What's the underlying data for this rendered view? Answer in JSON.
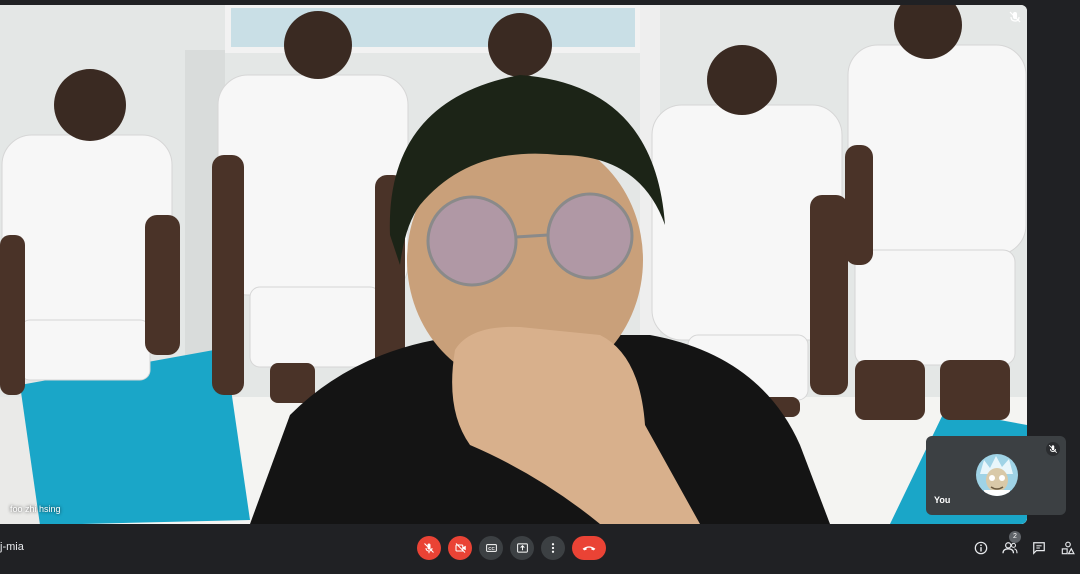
{
  "meeting": {
    "code_partial": "j-mia"
  },
  "main_tile": {
    "participant_name": "foo zhi hsing",
    "muted_icon": "mic-off-icon"
  },
  "self_tile": {
    "label": "You",
    "avatar_icon": "avatar-image",
    "muted_icon": "mic-off-icon"
  },
  "controls": [
    {
      "name": "mic-toggle",
      "icon": "mic-off-icon",
      "state": "off"
    },
    {
      "name": "camera-toggle",
      "icon": "camera-off-icon",
      "state": "off"
    },
    {
      "name": "captions-toggle",
      "icon": "closed-captions-icon"
    },
    {
      "name": "present-screen",
      "icon": "present-icon"
    },
    {
      "name": "more-options",
      "icon": "more-vert-icon"
    },
    {
      "name": "leave-call",
      "icon": "call-end-icon"
    }
  ],
  "right_tools": {
    "info_icon": "info-icon",
    "people_icon": "people-icon",
    "people_count": "2",
    "chat_icon": "chat-icon",
    "activities_icon": "activities-icon"
  },
  "colors": {
    "background": "#202124",
    "danger": "#ea4335",
    "button": "#3c4043",
    "text": "#e8eaed"
  }
}
